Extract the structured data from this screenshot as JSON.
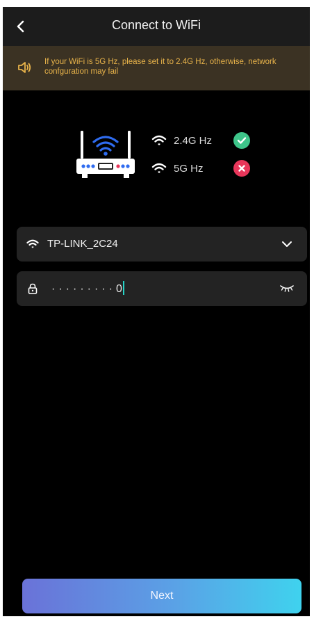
{
  "header": {
    "title": "Connect to WiFi",
    "back_icon": "chevron-left-icon"
  },
  "notice": {
    "icon": "speaker-icon",
    "text": "If your WiFi is 5G Hz, please set it to 2.4G Hz, otherwise, network confguration may fail"
  },
  "bands": [
    {
      "label": "2.4G Hz",
      "status": "supported",
      "icon": "check-icon"
    },
    {
      "label": "5G Hz",
      "status": "unsupported",
      "icon": "close-icon"
    }
  ],
  "wifi_field": {
    "ssid": "TP-LINK_2C24",
    "icon": "wifi-icon",
    "dropdown_icon": "chevron-down-icon"
  },
  "password_field": {
    "masked_value": "·········0",
    "icon": "lock-icon",
    "toggle_icon": "eye-closed-icon"
  },
  "footer": {
    "next_label": "Next"
  },
  "colors": {
    "background": "#000000",
    "notice_background": "#3b3223",
    "notice_text": "#e8b34a",
    "router_wifi_blue": "#2f6cf0",
    "check_green": "#3ec58a",
    "cross_red": "#e8365a",
    "caret_teal": "#27d3c6",
    "button_gradient_start": "#6a72d8",
    "button_gradient_end": "#3fd2ee"
  }
}
